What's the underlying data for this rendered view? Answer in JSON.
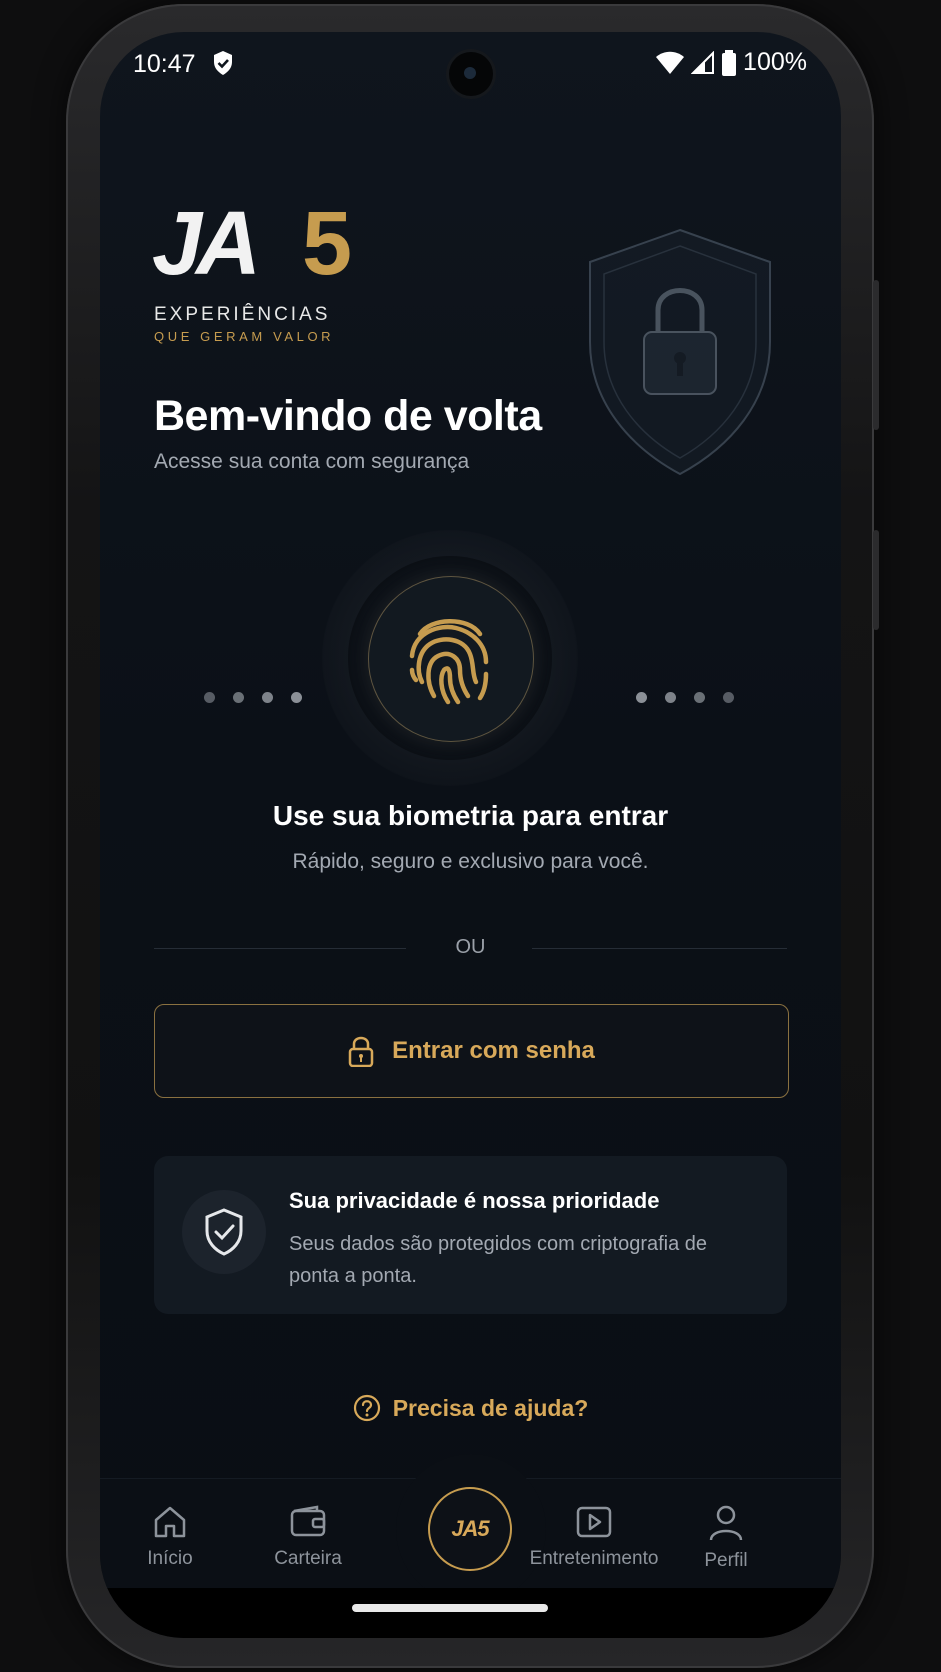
{
  "status_bar": {
    "time": "10:47",
    "battery": "100%"
  },
  "brand": {
    "logo_main": "JA5",
    "tagline_1": "EXPERIÊNCIAS",
    "tagline_2": "QUE GERAM VALOR"
  },
  "header": {
    "title": "Bem-vindo de volta",
    "subtitle": "Acesse sua conta com segurança"
  },
  "biometric": {
    "title": "Use sua biometria para entrar",
    "subtitle": "Rápido, seguro e exclusivo para você."
  },
  "divider": {
    "label": "OU"
  },
  "password_button": {
    "label": "Entrar com senha"
  },
  "privacy_card": {
    "title": "Sua privacidade é nossa prioridade",
    "text": "Seus dados são protegidos com criptografia de ponta a ponta."
  },
  "help": {
    "label": "Precisa de ajuda?"
  },
  "bottom_nav": {
    "items": [
      {
        "label": "Início",
        "icon": "home-icon"
      },
      {
        "label": "Carteira",
        "icon": "wallet-icon"
      },
      {
        "label": "JA5",
        "icon": "ja5-logo"
      },
      {
        "label": "Entretenimento",
        "icon": "play-icon"
      },
      {
        "label": "Perfil",
        "icon": "user-icon"
      }
    ]
  },
  "colors": {
    "accent_gold": "#c69c4f",
    "background": "#0b1017",
    "text_muted": "#a3a9b2"
  }
}
